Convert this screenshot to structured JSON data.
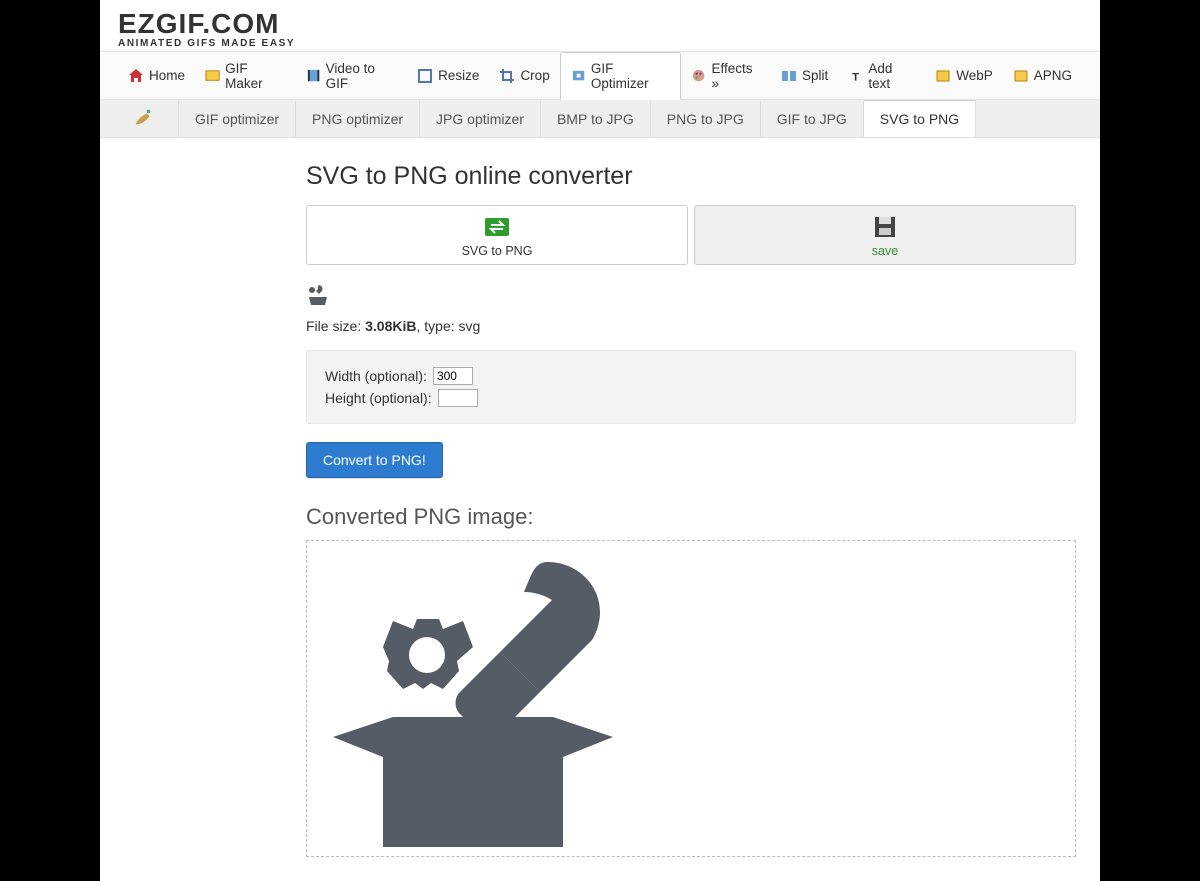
{
  "brand": {
    "line1": "EZGIF.COM",
    "line2": "ANIMATED GIFS MADE EASY"
  },
  "nav1": {
    "home": "Home",
    "gifmaker": "GIF Maker",
    "video": "Video to GIF",
    "resize": "Resize",
    "crop": "Crop",
    "optimizer": "GIF Optimizer",
    "effects": "Effects »",
    "split": "Split",
    "addtext": "Add text",
    "webp": "WebP",
    "apng": "APNG"
  },
  "nav2": {
    "gif": "GIF optimizer",
    "png": "PNG optimizer",
    "jpg": "JPG optimizer",
    "bmp2jpg": "BMP to JPG",
    "png2jpg": "PNG to JPG",
    "gif2jpg": "GIF to JPG",
    "svg2png": "SVG to PNG"
  },
  "page": {
    "title": "SVG to PNG online converter",
    "card1": "SVG to PNG",
    "card2": "save",
    "file_label": "File size: ",
    "file_size": "3.08KiB",
    "file_type": ", type: svg",
    "width_label": "Width (optional):",
    "width_value": "300",
    "height_label": "Height (optional):",
    "height_value": "",
    "convert": "Convert to PNG!",
    "result_title": "Converted PNG image:"
  }
}
